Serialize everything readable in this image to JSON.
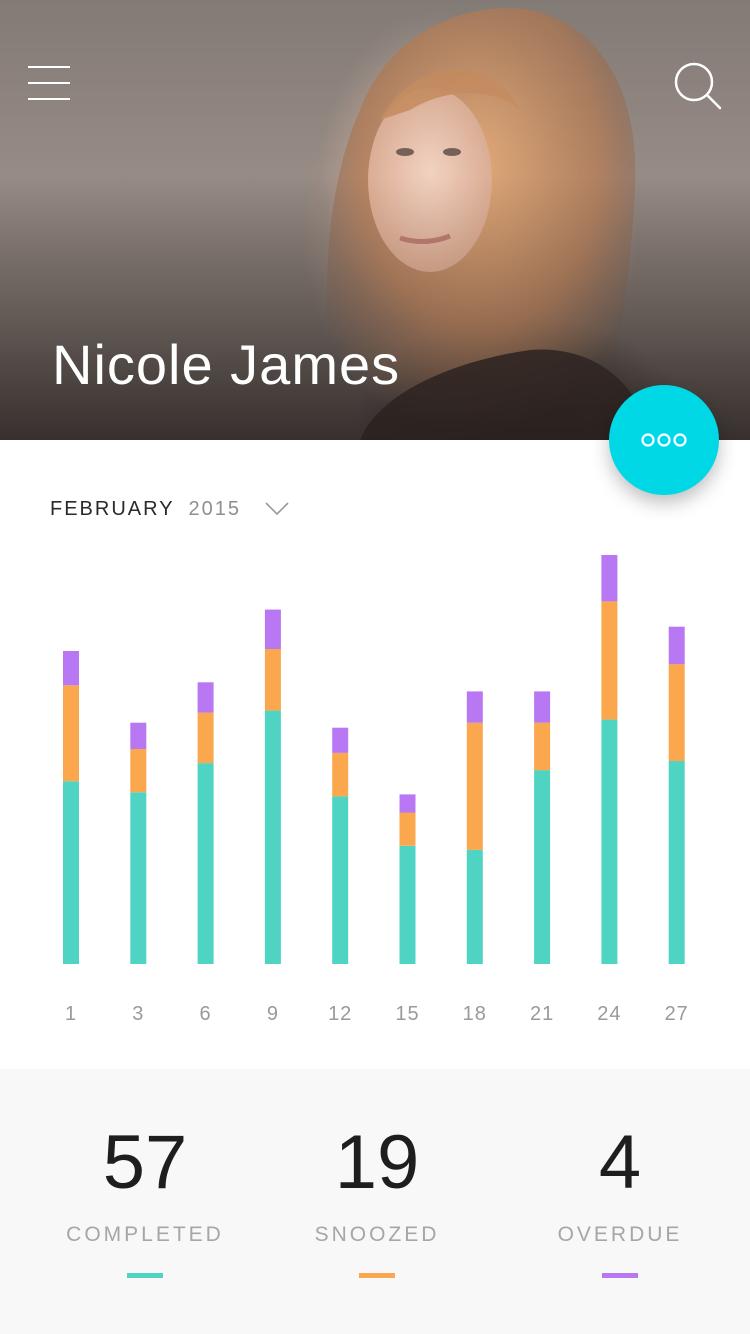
{
  "header": {
    "menu_icon": "hamburger-menu-icon",
    "search_icon": "search-icon",
    "name": "Nicole James"
  },
  "fab": {
    "icon": "more-dots-icon",
    "color": "#00D8E6"
  },
  "month_selector": {
    "month": "FEBRUARY",
    "year": "2015",
    "icon": "chevron-down-icon"
  },
  "colors": {
    "completed": "#4FD4C4",
    "snoozed": "#FAA74E",
    "overdue": "#B878F4",
    "accent": "#00D8E6"
  },
  "chart_data": {
    "type": "bar",
    "stacked": true,
    "categories": [
      "1",
      "3",
      "6",
      "9",
      "12",
      "15",
      "18",
      "21",
      "24",
      "27"
    ],
    "series": [
      {
        "name": "COMPLETED",
        "values": [
          181,
          170,
          199,
          251,
          166,
          117,
          113,
          192,
          242,
          201
        ]
      },
      {
        "name": "SNOOZED",
        "values": [
          95,
          43,
          50,
          61,
          43,
          33,
          126,
          47,
          117,
          96
        ]
      },
      {
        "name": "OVERDUE",
        "values": [
          34,
          26,
          30,
          39,
          25,
          18,
          31,
          31,
          46,
          37
        ]
      }
    ],
    "ylim": [
      0,
      410
    ],
    "grid": false,
    "legend": "none"
  },
  "stats": [
    {
      "value": "57",
      "label": "COMPLETED"
    },
    {
      "value": "19",
      "label": "SNOOZED"
    },
    {
      "value": "4",
      "label": "OVERDUE"
    }
  ]
}
